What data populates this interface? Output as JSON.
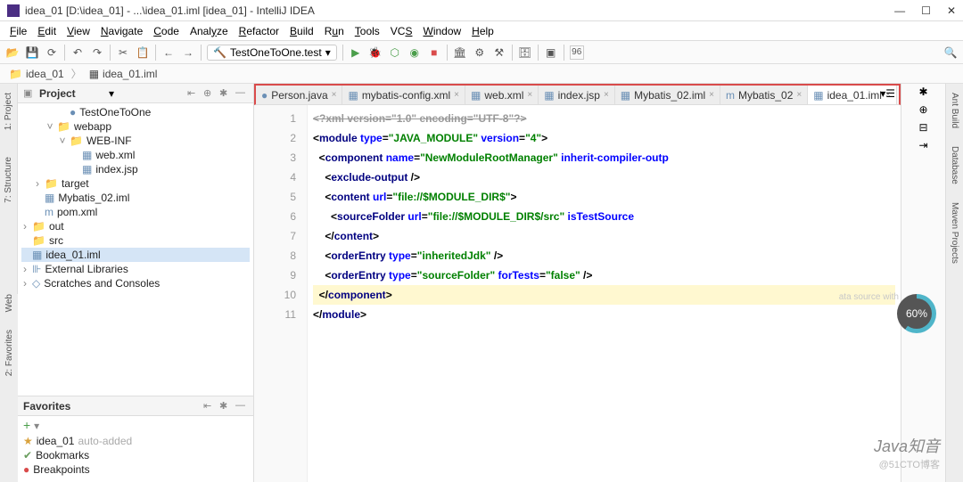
{
  "window": {
    "title": "idea_01 [D:\\idea_01] - ...\\idea_01.iml [idea_01] - IntelliJ IDEA"
  },
  "menu": [
    "File",
    "Edit",
    "View",
    "Navigate",
    "Code",
    "Analyze",
    "Refactor",
    "Build",
    "Run",
    "Tools",
    "VCS",
    "Window",
    "Help"
  ],
  "menu_underline_idx": [
    0,
    0,
    0,
    0,
    0,
    4,
    0,
    0,
    1,
    0,
    2,
    0,
    0
  ],
  "run_config": "TestOneToOne.test",
  "toolbar_num": "96",
  "breadcrumb": [
    "idea_01",
    "idea_01.iml"
  ],
  "project_panel": {
    "title": "Project"
  },
  "tree": [
    {
      "ind": 3,
      "tw": "",
      "icon": "●",
      "iconCls": "file-icn",
      "label": "TestOneToOne"
    },
    {
      "ind": 2,
      "tw": "˅",
      "icon": "📁",
      "iconCls": "folder-icn",
      "label": "webapp"
    },
    {
      "ind": 3,
      "tw": "˅",
      "icon": "📁",
      "iconCls": "folder-icn",
      "label": "WEB-INF"
    },
    {
      "ind": 4,
      "tw": "",
      "icon": "▦",
      "iconCls": "file-icn",
      "label": "web.xml"
    },
    {
      "ind": 4,
      "tw": "",
      "icon": "▦",
      "iconCls": "file-icn",
      "label": "index.jsp"
    },
    {
      "ind": 1,
      "tw": "›",
      "icon": "📁",
      "iconCls": "folder-icn",
      "label": "target"
    },
    {
      "ind": 1,
      "tw": "",
      "icon": "▦",
      "iconCls": "file-icn",
      "label": "Mybatis_02.iml"
    },
    {
      "ind": 1,
      "tw": "",
      "icon": "m",
      "iconCls": "file-icn",
      "label": "pom.xml"
    },
    {
      "ind": 0,
      "tw": "›",
      "icon": "📁",
      "iconCls": "folder-icn",
      "label": "out"
    },
    {
      "ind": 0,
      "tw": "",
      "icon": "📁",
      "iconCls": "folder-icn",
      "label": "src"
    },
    {
      "ind": 0,
      "tw": "",
      "icon": "▦",
      "iconCls": "file-icn",
      "label": "idea_01.iml",
      "selected": true
    },
    {
      "ind": 0,
      "tw": "›",
      "icon": "⊪",
      "iconCls": "file-icn",
      "label": "External Libraries"
    },
    {
      "ind": 0,
      "tw": "›",
      "icon": "◇",
      "iconCls": "file-icn",
      "label": "Scratches and Consoles"
    }
  ],
  "favorites": {
    "title": "Favorites",
    "items": [
      {
        "icon": "★",
        "color": "#d9a23d",
        "label": "idea_01",
        "suffix": "auto-added"
      },
      {
        "icon": "✔",
        "color": "#6a9e5e",
        "label": "Bookmarks",
        "suffix": ""
      },
      {
        "icon": "●",
        "color": "#d94b4b",
        "label": "Breakpoints",
        "suffix": ""
      }
    ]
  },
  "editor_tabs": [
    {
      "icon": "●",
      "label": "Person.java",
      "active": false
    },
    {
      "icon": "▦",
      "label": "mybatis-config.xml",
      "active": false
    },
    {
      "icon": "▦",
      "label": "web.xml",
      "active": false
    },
    {
      "icon": "▦",
      "label": "index.jsp",
      "active": false
    },
    {
      "icon": "▦",
      "label": "Mybatis_02.iml",
      "active": false
    },
    {
      "icon": "m",
      "label": "Mybatis_02",
      "active": false
    },
    {
      "icon": "▦",
      "label": "idea_01.iml",
      "active": true
    }
  ],
  "code_lines": [
    {
      "n": 1,
      "html": "<span class='gray'>&lt;?xml version=\"1.0\" encoding=\"UTF-8\"?&gt;</span>"
    },
    {
      "n": 2,
      "html": "&lt;<span class='tag'>module</span> <span class='attr'>type</span>=<span class='str'>\"JAVA_MODULE\"</span> <span class='attr'>version</span>=<span class='str'>\"4\"</span>&gt;"
    },
    {
      "n": 3,
      "html": "  &lt;<span class='tag'>component</span> <span class='attr'>name</span>=<span class='str'>\"NewModuleRootManager\"</span> <span class='attr'>inherit-compiler-outp</span>"
    },
    {
      "n": 4,
      "html": "    &lt;<span class='tag'>exclude-output</span> /&gt;"
    },
    {
      "n": 5,
      "html": "    &lt;<span class='tag'>content</span> <span class='attr'>url</span>=<span class='str'>\"file://$MODULE_DIR$\"</span>&gt;"
    },
    {
      "n": 6,
      "html": "      &lt;<span class='tag'>sourceFolder</span> <span class='attr'>url</span>=<span class='str'>\"file://$MODULE_DIR$/src\"</span> <span class='attr'>isTestSource</span>"
    },
    {
      "n": 7,
      "html": "    &lt;/<span class='tag'>content</span>&gt;"
    },
    {
      "n": 8,
      "html": "    &lt;<span class='tag'>orderEntry</span> <span class='attr'>type</span>=<span class='str'>\"inheritedJdk\"</span> /&gt;"
    },
    {
      "n": 9,
      "html": "    &lt;<span class='tag'>orderEntry</span> <span class='attr'>type</span>=<span class='str'>\"sourceFolder\"</span> <span class='attr'>forTests</span>=<span class='str'>\"false\"</span> /&gt;"
    },
    {
      "n": 10,
      "html": "  &lt;/<span class='tag'>component</span>&gt;",
      "hl": true
    },
    {
      "n": 11,
      "html": "&lt;/<span class='tag'>module</span>&gt;"
    }
  ],
  "left_rail": [
    "1: Project",
    "7: Structure"
  ],
  "left_bottom_rail": [
    "Web",
    "2: Favorites"
  ],
  "right_rail": [
    "Ant Build",
    "Database",
    "Maven Projects"
  ],
  "faint_text": "ata source with",
  "progress": "60%",
  "watermark": {
    "a": "Java知音",
    "b": "@51CTO博客"
  }
}
